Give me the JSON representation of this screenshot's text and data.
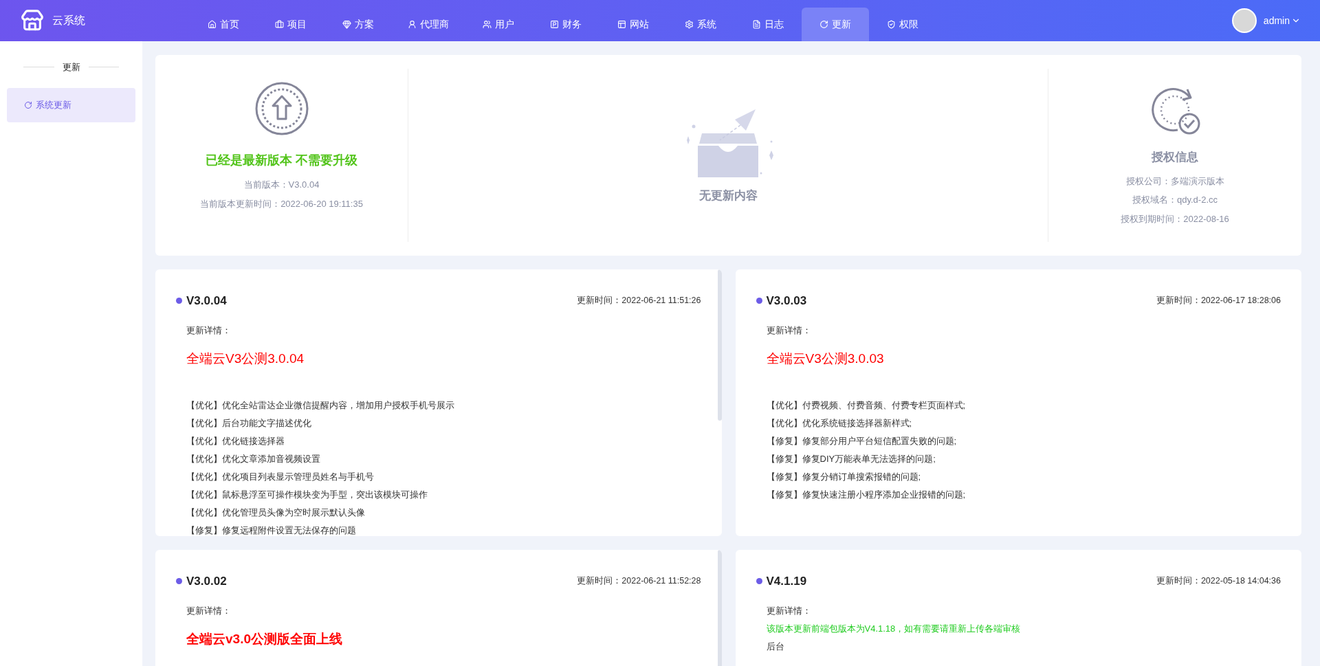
{
  "header": {
    "brand": "云系统",
    "nav": [
      {
        "label": "首页",
        "selected": false
      },
      {
        "label": "项目",
        "selected": false
      },
      {
        "label": "方案",
        "selected": false
      },
      {
        "label": "代理商",
        "selected": false
      },
      {
        "label": "用户",
        "selected": false
      },
      {
        "label": "财务",
        "selected": false
      },
      {
        "label": "网站",
        "selected": false
      },
      {
        "label": "系统",
        "selected": false
      },
      {
        "label": "日志",
        "selected": false
      },
      {
        "label": "更新",
        "selected": true
      },
      {
        "label": "权限",
        "selected": false
      }
    ],
    "user": "admin"
  },
  "sidebar": {
    "title": "更新",
    "items": [
      {
        "label": "系统更新",
        "selected": true
      }
    ]
  },
  "status": {
    "version_title": "已经是最新版本 不需要升级",
    "current_version": "当前版本：V3.0.04",
    "current_time": "当前版本更新时间：2022-06-20 19:11:35",
    "empty_text": "无更新内容",
    "auth_title": "授权信息",
    "auth_lines": [
      "授权公司：多端演示版本",
      "授权域名：qdy.d-2.cc",
      "授权到期时间：2022-08-16"
    ]
  },
  "releases": [
    {
      "version": "V3.0.04",
      "time": "更新时间：2022-06-21 11:51:26",
      "details_label": "更新详情：",
      "headline": "全端云V3公测3.0.04",
      "headline_bold": false,
      "lines": [
        {
          "text": "【优化】优化全站雷达企业微信提醒内容，增加用户授权手机号展示",
          "kind": "normal"
        },
        {
          "text": "【优化】后台功能文字描述优化",
          "kind": "normal"
        },
        {
          "text": "【优化】优化链接选择器",
          "kind": "normal"
        },
        {
          "text": "【优化】优化文章添加音视频设置",
          "kind": "normal"
        },
        {
          "text": "【优化】优化项目列表显示管理员姓名与手机号",
          "kind": "normal"
        },
        {
          "text": "【优化】鼠标悬浮至可操作模块变为手型，突出该模块可操作",
          "kind": "normal"
        },
        {
          "text": "【优化】优化管理员头像为空时展示默认头像",
          "kind": "normal"
        },
        {
          "text": "【修复】修复远程附件设置无法保存的问题",
          "kind": "normal"
        }
      ]
    },
    {
      "version": "V3.0.03",
      "time": "更新时间：2022-06-17 18:28:06",
      "details_label": "更新详情：",
      "headline": "全端云V3公测3.0.03",
      "headline_bold": false,
      "lines": [
        {
          "text": "【优化】付费视频、付费音频、付费专栏页面样式;",
          "kind": "normal"
        },
        {
          "text": "【优化】优化系统链接选择器新样式;",
          "kind": "normal"
        },
        {
          "text": "【修复】修复部分用户平台短信配置失败的问题;",
          "kind": "normal"
        },
        {
          "text": "【修复】修复DIY万能表单无法选择的问题;",
          "kind": "normal"
        },
        {
          "text": "【修复】修复分销订单搜索报错的问题;",
          "kind": "normal"
        },
        {
          "text": "【修复】修复快速注册小程序添加企业报错的问题;",
          "kind": "normal"
        }
      ]
    },
    {
      "version": "V3.0.02",
      "time": "更新时间：2022-06-21 11:52:28",
      "details_label": "更新详情：",
      "headline": "全端云v3.0公测版全面上线",
      "headline_bold": true
    },
    {
      "version": "V4.1.19",
      "time": "更新时间：2022-05-18 14:04:36",
      "details_label": "更新详情：",
      "lines": [
        {
          "text": "该版本更新前端包版本为V4.1.18，如有需要请重新上传各端审核",
          "kind": "notice"
        },
        {
          "text": "后台",
          "kind": "normal"
        }
      ]
    }
  ]
}
